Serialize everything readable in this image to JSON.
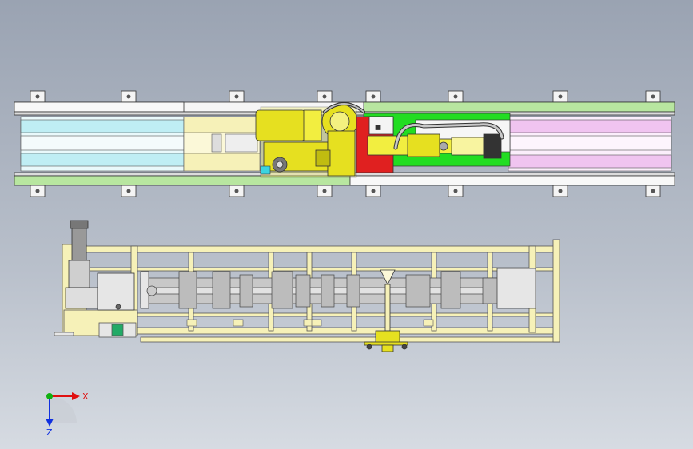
{
  "viewport": {
    "background_top": "#9aa3b2",
    "background_bottom": "#d6dbe2"
  },
  "triad": {
    "x_label": "X",
    "z_label": "Z",
    "x_color": "#e01010",
    "y_color": "#10b010",
    "z_color": "#1030e0"
  },
  "colors": {
    "rail_green": "#b8e6a0",
    "cyan_panel": "#bfeef4",
    "pink_panel": "#f0c4f0",
    "frame_yellow": "#f6f1b8",
    "robot_yellow": "#e6e020",
    "red_block": "#e02020",
    "bright_green": "#22dd22",
    "steel_grey": "#9a9a9a"
  },
  "views": {
    "top_view": "top-view",
    "front_view": "front-view"
  }
}
